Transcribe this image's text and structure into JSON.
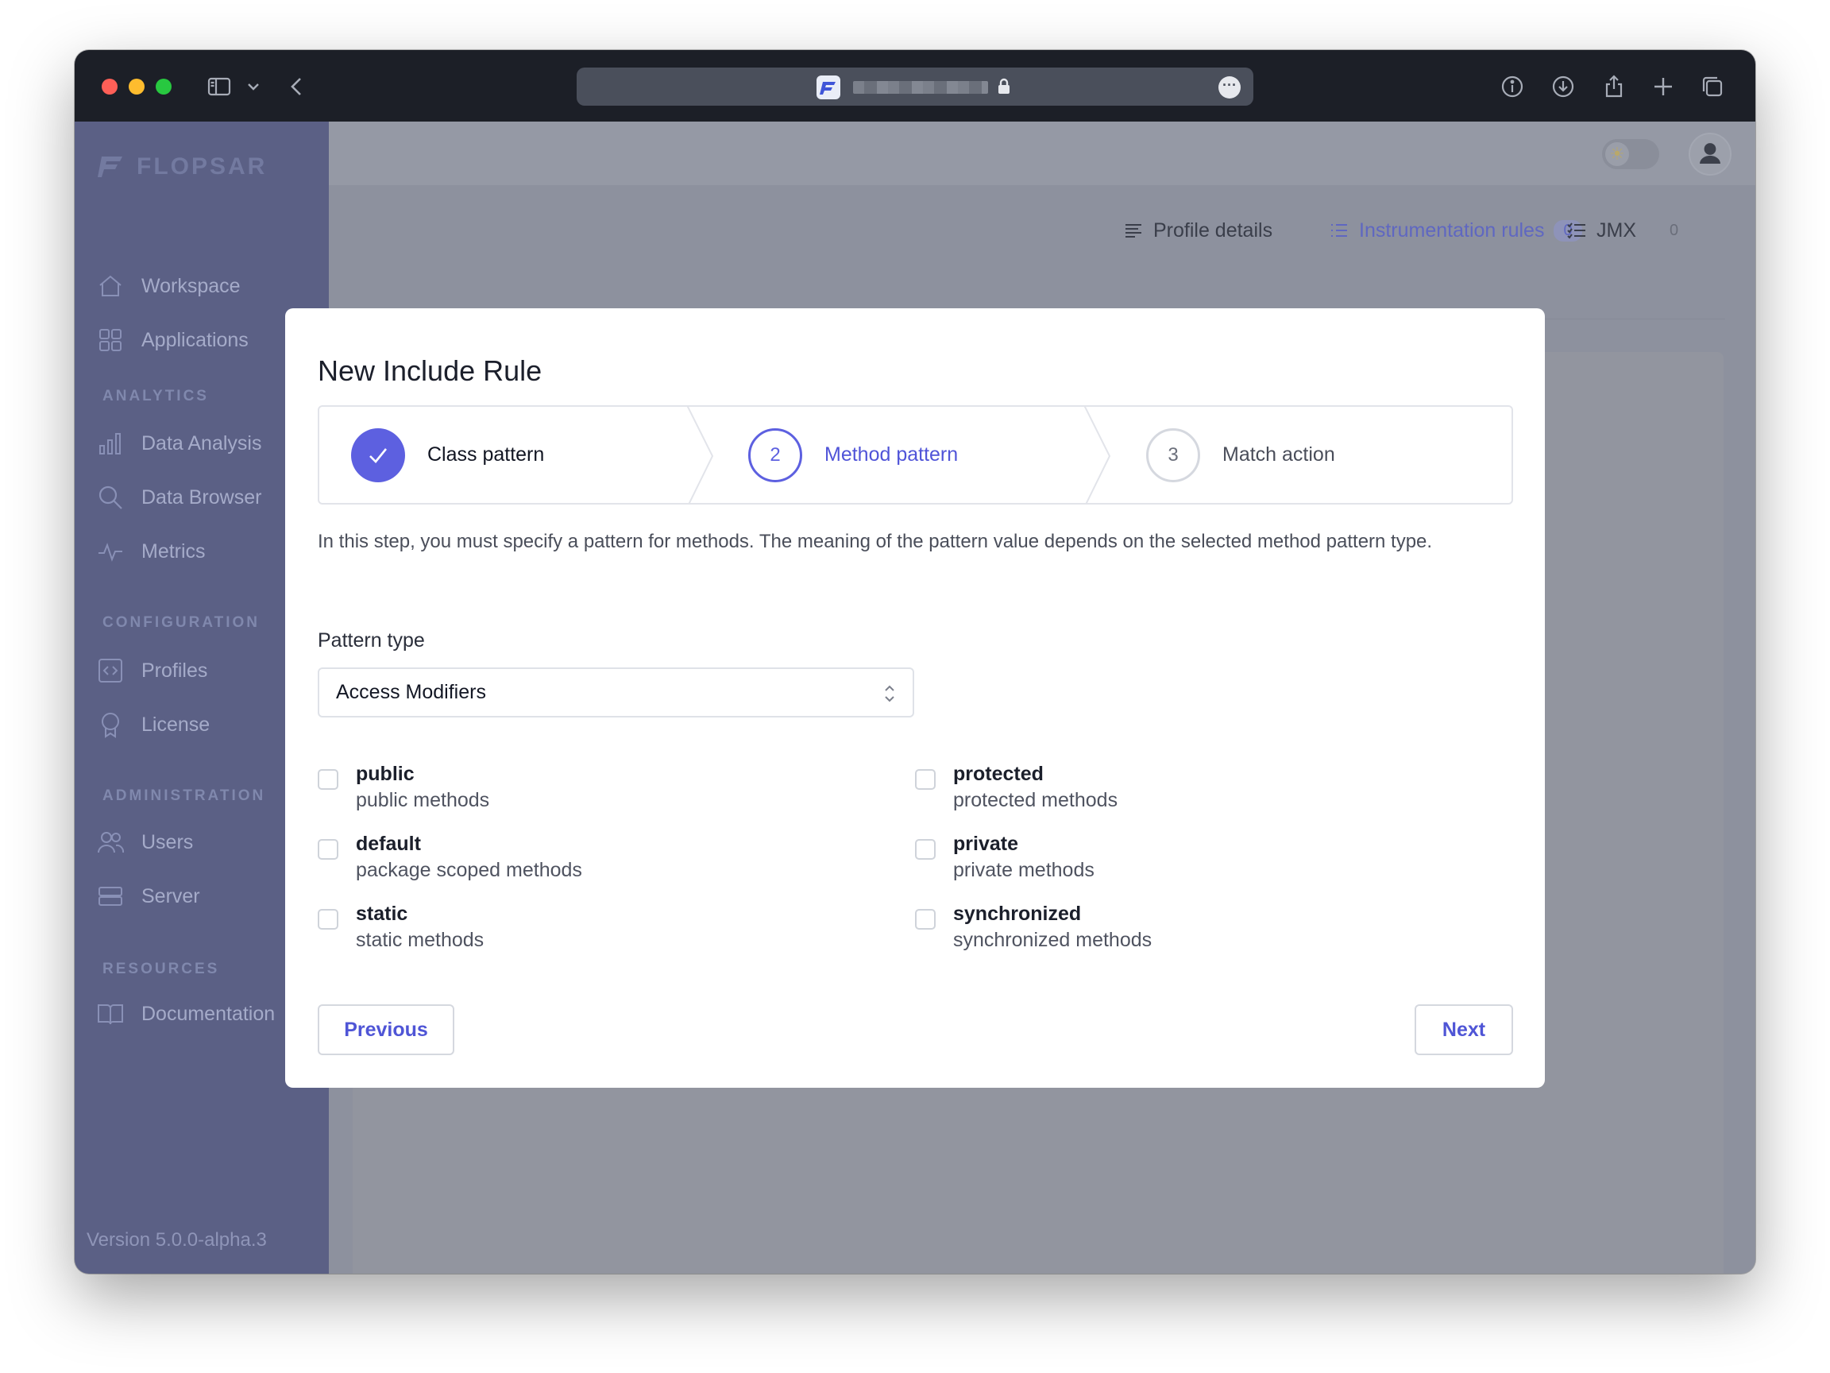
{
  "browser": {
    "icons": [
      "sidebar-icon",
      "chevron-down-icon",
      "back-icon",
      "lock-icon",
      "more-icon",
      "info-icon",
      "download-icon",
      "share-icon",
      "new-tab-icon",
      "tabs-icon"
    ]
  },
  "sidebar": {
    "brand": "FLOPSAR",
    "items_top": [
      {
        "label": "Workspace",
        "icon": "home-icon"
      },
      {
        "label": "Applications",
        "icon": "grid-icon"
      }
    ],
    "sections": [
      {
        "title": "ANALYTICS",
        "items": [
          {
            "label": "Data Analysis",
            "icon": "bar-chart-icon"
          },
          {
            "label": "Data Browser",
            "icon": "search-icon"
          },
          {
            "label": "Metrics",
            "icon": "pulse-icon"
          }
        ]
      },
      {
        "title": "CONFIGURATION",
        "items": [
          {
            "label": "Profiles",
            "icon": "code-icon"
          },
          {
            "label": "License",
            "icon": "badge-icon"
          }
        ]
      },
      {
        "title": "ADMINISTRATION",
        "items": [
          {
            "label": "Users",
            "icon": "users-icon"
          },
          {
            "label": "Server",
            "icon": "server-icon"
          }
        ]
      },
      {
        "title": "RESOURCES",
        "items": [
          {
            "label": "Documentation",
            "icon": "book-icon"
          }
        ]
      }
    ],
    "version": "Version 5.0.0-alpha.3"
  },
  "tabs": [
    {
      "label": "Profile details",
      "icon": "list-icon",
      "count": ""
    },
    {
      "label": "Instrumentation rules",
      "icon": "list-icon",
      "count": "0",
      "active": true
    },
    {
      "label": "JMX",
      "icon": "checklist-icon",
      "count": "0"
    }
  ],
  "modal": {
    "title": "New Include Rule",
    "steps": [
      {
        "number": "",
        "label": "Class pattern",
        "state": "done"
      },
      {
        "number": "2",
        "label": "Method pattern",
        "state": "current"
      },
      {
        "number": "3",
        "label": "Match action",
        "state": "upcoming"
      }
    ],
    "description": "In this step, you must specify a pattern for methods. The meaning of the pattern value depends on the selected method pattern type.",
    "pattern_type_label": "Pattern type",
    "pattern_type_value": "Access Modifiers",
    "modifiers": [
      {
        "name": "public",
        "desc": "public methods",
        "checked": false
      },
      {
        "name": "protected",
        "desc": "protected methods",
        "checked": false
      },
      {
        "name": "default",
        "desc": "package scoped methods",
        "checked": false
      },
      {
        "name": "private",
        "desc": "private methods",
        "checked": false
      },
      {
        "name": "static",
        "desc": "static methods",
        "checked": false
      },
      {
        "name": "synchronized",
        "desc": "synchronized methods",
        "checked": false
      }
    ],
    "previous_label": "Previous",
    "next_label": "Next"
  },
  "colors": {
    "accent": "#5d60e0",
    "sidebar": "#5b6085",
    "overlay": "#8d919e"
  }
}
